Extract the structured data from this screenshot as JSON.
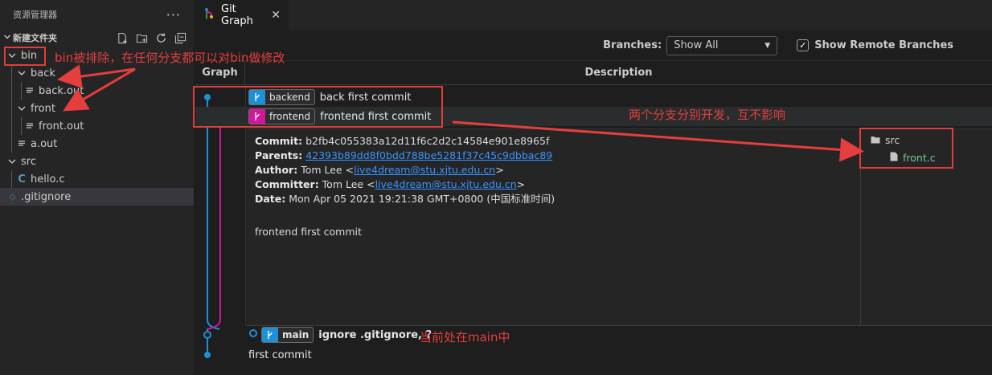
{
  "sidebar": {
    "title": "资源管理器",
    "more": "···",
    "section": "新建文件夹",
    "tree": [
      {
        "label": "bin",
        "type": "folder"
      },
      {
        "label": "back",
        "type": "folder"
      },
      {
        "label": "back.out",
        "type": "file"
      },
      {
        "label": "front",
        "type": "folder"
      },
      {
        "label": "front.out",
        "type": "file"
      },
      {
        "label": "a.out",
        "type": "file"
      },
      {
        "label": "src",
        "type": "folder"
      },
      {
        "label": "hello.c",
        "type": "c-file",
        "icon_glyph": "C"
      },
      {
        "label": ".gitignore",
        "type": "git-file"
      }
    ]
  },
  "tab": {
    "label": "Git Graph",
    "close": "✕"
  },
  "controls": {
    "branches_label": "Branches:",
    "branches_value": "Show All",
    "show_remote_label": "Show Remote Branches",
    "checkmark": "✓"
  },
  "columns": {
    "graph": "Graph",
    "description": "Description"
  },
  "commits": [
    {
      "ref": "backend",
      "message": "back first commit"
    },
    {
      "ref": "frontend",
      "message": "frontend first commit"
    },
    {
      "ref": "main",
      "message": "ignore .gitignore, ?"
    },
    {
      "message": "first commit"
    }
  ],
  "details": {
    "commit_label": "Commit:",
    "commit_value": "b2fb4c055383a12d11f6c2d2c14584e901e8965f",
    "parents_label": "Parents:",
    "parents_value": "42393b89dd8f0bdd788be5281f37c45c9dbbac89",
    "author_label": "Author:",
    "author_name": "Tom Lee <",
    "author_email": "live4dream@stu.xjtu.edu.cn",
    "author_end": ">",
    "committer_label": "Committer:",
    "committer_name": "Tom Lee <",
    "committer_email": "live4dream@stu.xjtu.edu.cn",
    "committer_end": ">",
    "date_label": "Date:",
    "date_value": "Mon Apr 05 2021 19:21:38 GMT+0800 (中国标准时间)",
    "message": "frontend first commit",
    "files": {
      "folder": "src",
      "file": "front.c"
    }
  },
  "annotations": {
    "bin_note": "bin被排除，在任何分支都可以对bin做修改",
    "branches_note": "两个分支分别开发，互不影响",
    "main_note": "当前处在main中"
  },
  "colors": {
    "backend_branch": "#1e90d6",
    "frontend_branch": "#d4179a",
    "annotation_red": "#e53e3e",
    "added_file_green": "#73c991"
  }
}
